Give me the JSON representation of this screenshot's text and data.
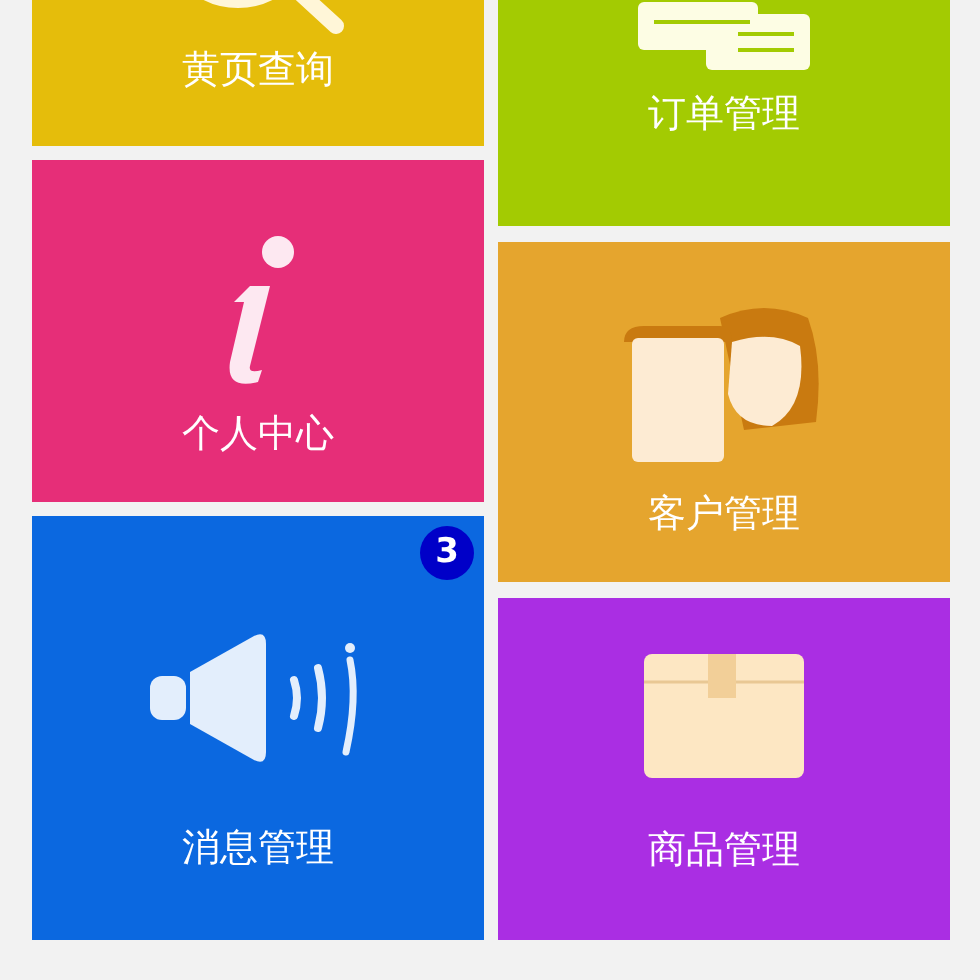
{
  "columns": [
    [
      {
        "label": "黄页查询",
        "kind": "search",
        "color": "#e5bd0b"
      },
      {
        "label": "个人中心",
        "kind": "info",
        "color": "#e62e78"
      },
      {
        "label": "消息管理",
        "kind": "speaker",
        "color": "#0b68e0",
        "badge": "3"
      }
    ],
    [
      {
        "label": "订单管理",
        "kind": "document",
        "color": "#a3cb02"
      },
      {
        "label": "客户管理",
        "kind": "people",
        "color": "#e5a52e"
      },
      {
        "label": "商品管理",
        "kind": "box",
        "color": "#aa2ee3"
      }
    ]
  ]
}
